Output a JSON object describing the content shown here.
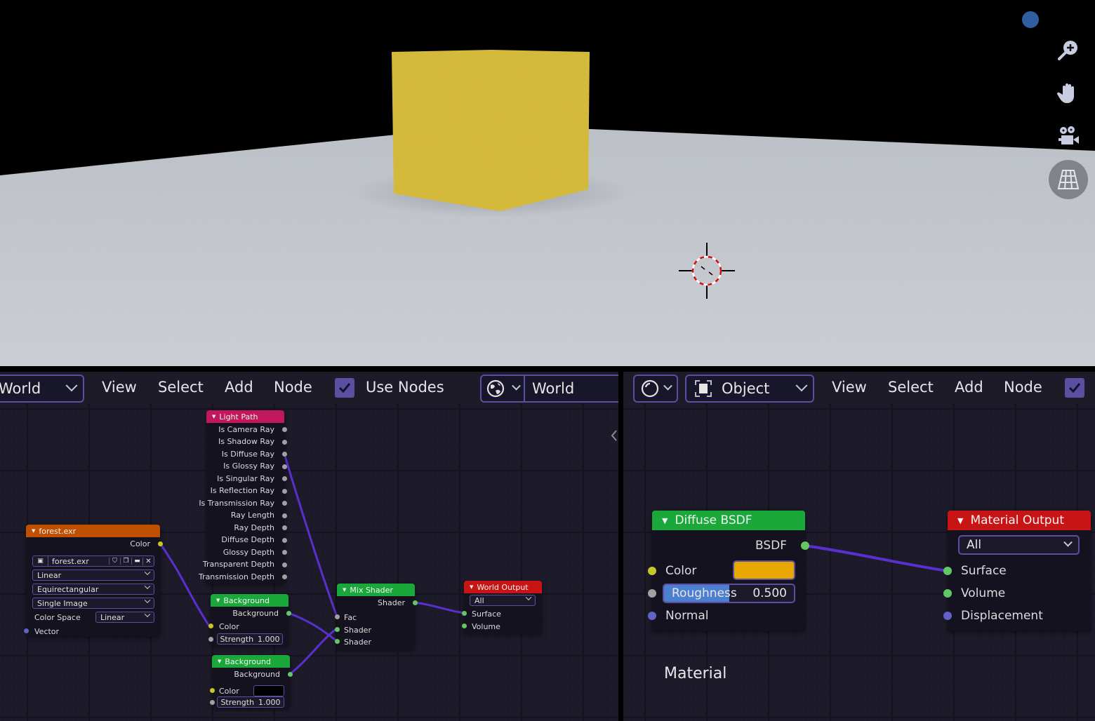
{
  "viewport": {
    "navigation_icons": [
      "zoom-in-icon",
      "hand-pan-icon",
      "camera-icon",
      "perspective-grid-icon"
    ],
    "gizmo_color": "#2f5f9e",
    "cube_color": "#d4b800",
    "floor_color": "#c9ccd2"
  },
  "world_editor": {
    "world_dropdown": "World",
    "menu": [
      "View",
      "Select",
      "Add",
      "Node"
    ],
    "use_nodes_label": "Use Nodes",
    "use_nodes_checked": true,
    "world_name": "World",
    "nodes": {
      "environment_texture": {
        "title": "forest.exr",
        "output": "Color",
        "image_name": "forest.exr",
        "interpolation": "Linear",
        "projection": "Equirectangular",
        "source": "Single Image",
        "color_space_label": "Color Space",
        "color_space": "Linear",
        "input": "Vector",
        "header_color": "#c05000"
      },
      "light_path": {
        "title": "Light Path",
        "header_color": "#c0185a",
        "outputs": [
          "Is Camera Ray",
          "Is Shadow Ray",
          "Is Diffuse Ray",
          "Is Glossy Ray",
          "Is Singular Ray",
          "Is Reflection Ray",
          "Is Transmission Ray",
          "Ray Length",
          "Ray Depth",
          "Diffuse Depth",
          "Glossy Depth",
          "Transparent Depth",
          "Transmission Depth"
        ]
      },
      "background_1": {
        "title": "Background",
        "output": "Background",
        "color_label": "Color",
        "strength_label": "Strength",
        "strength": "1.000"
      },
      "background_2": {
        "title": "Background",
        "output": "Background",
        "color_label": "Color",
        "strength_label": "Strength",
        "strength": "1.000",
        "color_value": "#000000"
      },
      "mix_shader": {
        "title": "Mix Shader",
        "output": "Shader",
        "inputs": [
          "Fac",
          "Shader",
          "Shader"
        ]
      },
      "world_output": {
        "title": "World Output",
        "target": "All",
        "inputs": [
          "Surface",
          "Volume"
        ],
        "header_color": "#c81414"
      }
    }
  },
  "material_editor": {
    "object_type": "Object",
    "menu": [
      "View",
      "Select",
      "Add",
      "Node"
    ],
    "use_nodes_checked": true,
    "area_label": "Material",
    "nodes": {
      "diffuse_bsdf": {
        "title": "Diffuse BSDF",
        "output": "BSDF",
        "color_label": "Color",
        "color_value": "#e8a800",
        "roughness_label": "Roughness",
        "roughness": "0.500",
        "roughness_fraction": 0.5,
        "normal_label": "Normal"
      },
      "material_output": {
        "title": "Material Output",
        "target": "All",
        "inputs": [
          "Surface",
          "Volume",
          "Displacement"
        ]
      }
    }
  }
}
